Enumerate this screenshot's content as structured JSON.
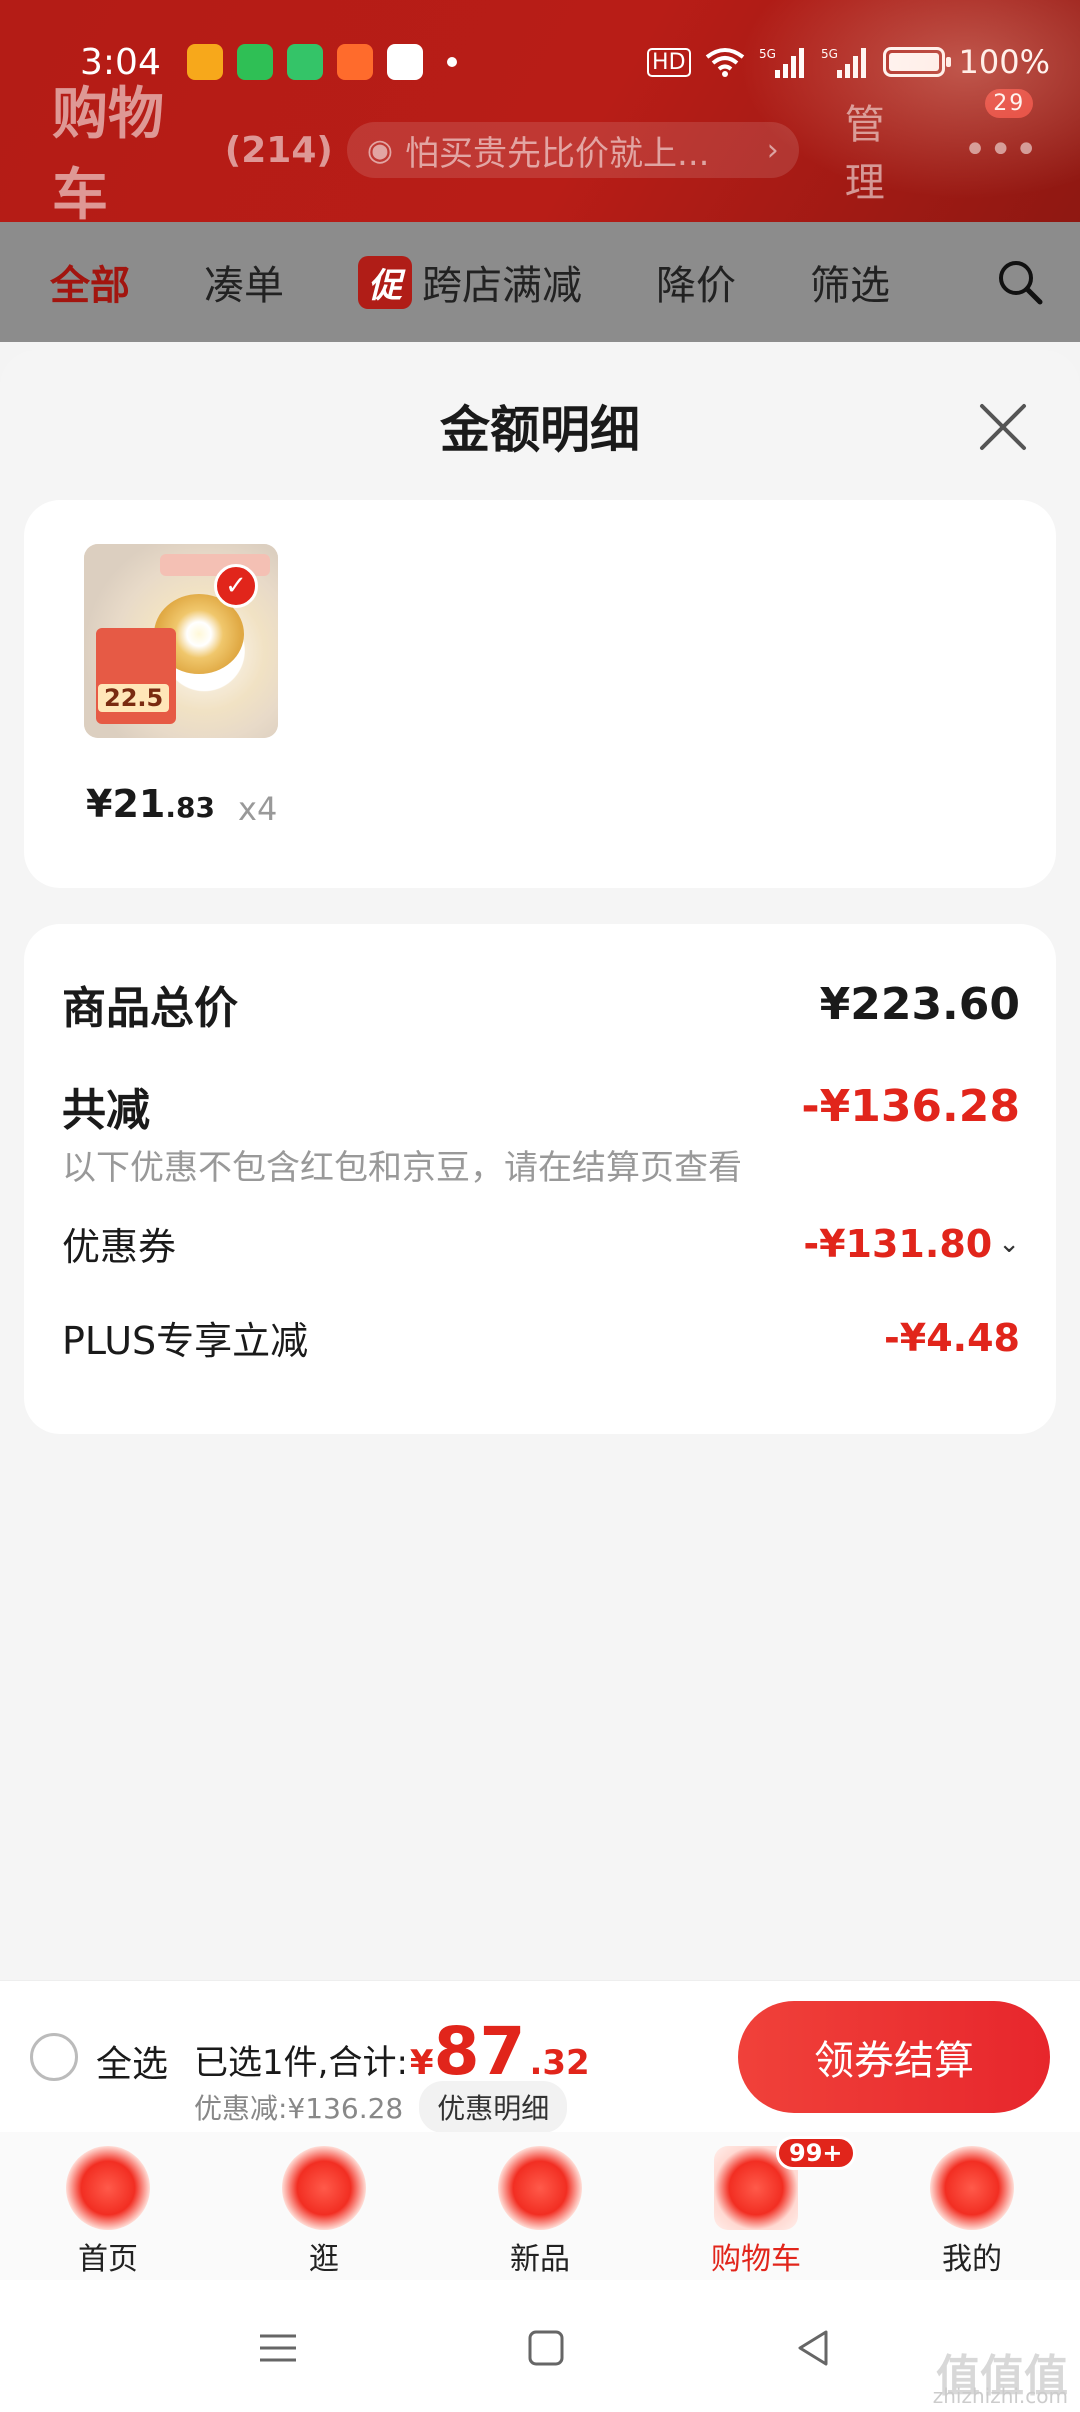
{
  "status_bar": {
    "time": "3:04",
    "battery": "100%",
    "network": "5G"
  },
  "header": {
    "title": "购物车",
    "count": "(214)",
    "search_placeholder": "怕买贵先比价就上...",
    "manage": "管理",
    "more_badge": "29"
  },
  "tabs": [
    {
      "label": "全部"
    },
    {
      "label": "凑单"
    },
    {
      "label": "跨店满减",
      "tag": "促"
    },
    {
      "label": "降价"
    },
    {
      "label": "筛选"
    }
  ],
  "sheet": {
    "title": "金额明细",
    "product": {
      "price_int": "¥21",
      "price_dec": ".83",
      "qty": "x4",
      "thumb_price": "22.5"
    },
    "summary": {
      "total_label": "商品总价",
      "total_value": "¥223.60",
      "reduce_label": "共减",
      "reduce_value": "-¥136.28",
      "note": "以下优惠不包含红包和京豆，请在结算页查看",
      "coupon_label": "优惠券",
      "coupon_value": "-¥131.80",
      "plus_label": "PLUS专享立减",
      "plus_value": "-¥4.48"
    }
  },
  "checkout": {
    "select_all": "全选",
    "selected_text": "已选1件,合计:",
    "currency": "¥",
    "total_int": "87",
    "total_dec": ".32",
    "discount_text": "优惠减:¥136.28",
    "detail_chip": "优惠明细",
    "pay_button": "领券结算"
  },
  "tabbar": {
    "items": [
      {
        "label": "首页"
      },
      {
        "label": "逛"
      },
      {
        "label": "新品"
      },
      {
        "label": "购物车",
        "badge": "99+"
      },
      {
        "label": "我的"
      }
    ]
  },
  "watermark": {
    "text": "值值值",
    "sub": "zhizhizhi.com"
  },
  "colors": {
    "brand_red": "#e1251b",
    "header_red": "#b41c16"
  }
}
